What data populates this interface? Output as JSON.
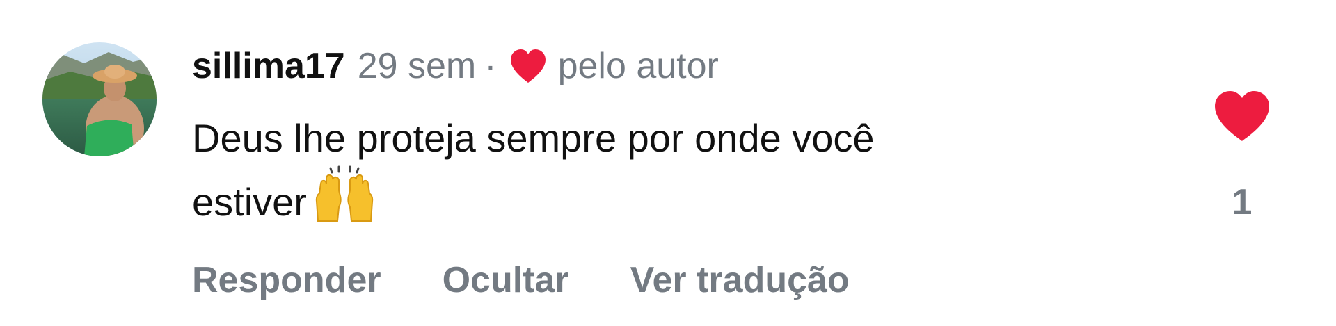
{
  "comment": {
    "username": "sillima17",
    "time": "29 sem",
    "separator": "·",
    "liked_by_author_label": "pelo autor",
    "text": "Deus lhe proteja sempre por onde você\nestiver",
    "emoji": "🙌",
    "emoji_icon": "raised-hands-icon",
    "like_count": "1",
    "like_color": "#ed1c3f"
  },
  "actions": {
    "reply_label": "Responder",
    "hide_label": "Ocultar",
    "translate_label": "Ver tradução"
  },
  "colors": {
    "text": "#111111",
    "secondary": "#737a82",
    "heart": "#ed1c3f"
  }
}
